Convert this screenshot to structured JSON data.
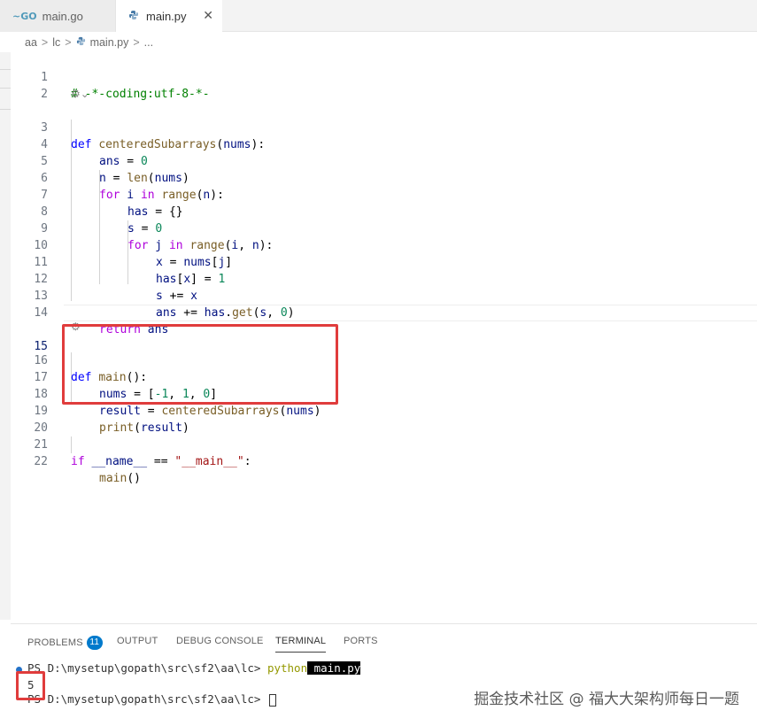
{
  "tabs": [
    {
      "label": "main.go",
      "icon": "go-icon",
      "active": false
    },
    {
      "label": "main.py",
      "icon": "python-icon",
      "active": true,
      "close": "✕"
    }
  ],
  "breadcrumb": {
    "parts": [
      "aa",
      "lc",
      "main.py",
      "..."
    ],
    "sep": ">"
  },
  "editor": {
    "line_numbers": [
      "1",
      "2",
      "3",
      "4",
      "5",
      "6",
      "7",
      "8",
      "9",
      "10",
      "11",
      "12",
      "13",
      "14",
      "15",
      "16",
      "17",
      "18",
      "19",
      "20",
      "21",
      "22"
    ],
    "code": {
      "l1": "# -*-coding:utf-8-*-",
      "l3": {
        "def": "def",
        "name": "centeredSubarrays",
        "open": "(",
        "arg": "nums",
        "close": "):"
      },
      "l4": {
        "v": "ans",
        "op": " = ",
        "n": "0"
      },
      "l5": {
        "v": "n",
        "op": " = ",
        "f": "len",
        "o": "(",
        "a": "nums",
        "c": ")"
      },
      "l6": {
        "kw": "for",
        "v": " i ",
        "in": "in",
        "f": " range",
        "o": "(",
        "a": "n",
        "c": "):"
      },
      "l7": {
        "v": "has",
        "op": " = ",
        "rest": "{}"
      },
      "l8": {
        "v": "s",
        "op": " = ",
        "n": "0"
      },
      "l9": {
        "kw": "for",
        "v": " j ",
        "in": "in",
        "f": " range",
        "o": "(",
        "a": "i",
        "m": ", ",
        "b": "n",
        "c": "):"
      },
      "l10": {
        "v": "x",
        "op": " = ",
        "a": "nums",
        "o": "[",
        "b": "j",
        "c": "]"
      },
      "l11": {
        "a": "has",
        "o": "[",
        "b": "x",
        "c": "]",
        "op": " = ",
        "n": "1"
      },
      "l12": {
        "a": "s",
        "op": " += ",
        "b": "x"
      },
      "l13": {
        "a": "ans",
        "op": " += ",
        "b": "has",
        "dot": ".",
        "f": "get",
        "o": "(",
        "c": "s",
        "m": ", ",
        "n": "0",
        "e": ")"
      },
      "l14": {
        "kw": "return",
        "v": " ans"
      },
      "l16": {
        "def": "def",
        "name": "main",
        "rest": "():"
      },
      "l17": {
        "v": "nums",
        "op": " = ",
        "o": "[",
        "n1": "-1",
        "m1": ", ",
        "n2": "1",
        "m2": ", ",
        "n3": "0",
        "c": "]"
      },
      "l18": {
        "v": "result",
        "op": " = ",
        "f": "centeredSubarrays",
        "o": "(",
        "a": "nums",
        "c": ")"
      },
      "l19": {
        "f": "print",
        "o": "(",
        "a": "result",
        "c": ")"
      },
      "l21": {
        "kw": "if",
        "v": " __name__",
        "op": " == ",
        "s": "\"__main__\"",
        "c": ":"
      },
      "l22": {
        "f": "main",
        "c": "()"
      }
    },
    "codelens_icon": "⚙⌄"
  },
  "panel": {
    "tabs": [
      "PROBLEMS",
      "OUTPUT",
      "DEBUG CONSOLE",
      "TERMINAL",
      "PORTS"
    ],
    "problems_count": "11",
    "active_tab": "TERMINAL",
    "terminal": {
      "prompt1": "PS D:\\mysetup\\gopath\\src\\sf2\\aa\\lc> ",
      "cmd": "python",
      "arg": " main.py",
      "output": "5",
      "prompt2": "PS D:\\mysetup\\gopath\\src\\sf2\\aa\\lc> "
    },
    "watermark": "掘金技术社区 @ 福大大架构师每日一题"
  },
  "colors": {
    "highlight_box": "#e03c3c",
    "badge": "#007acc"
  }
}
